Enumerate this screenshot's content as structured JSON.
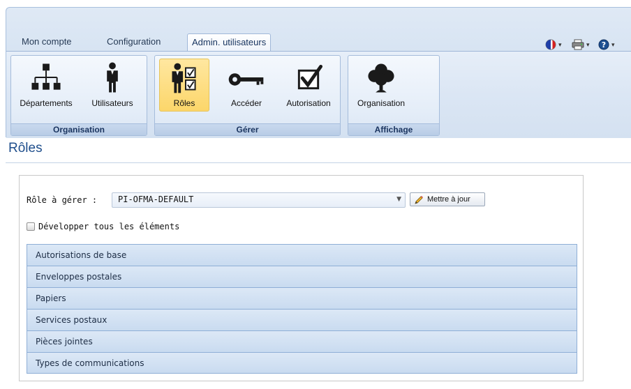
{
  "tabs": [
    {
      "label": "Mon compte",
      "active": false
    },
    {
      "label": "Configuration",
      "active": false
    },
    {
      "label": "Admin. utilisateurs",
      "active": true
    }
  ],
  "toolbar_icons": [
    {
      "name": "flag-icon"
    },
    {
      "name": "printer-icon"
    },
    {
      "name": "help-icon"
    }
  ],
  "groups": [
    {
      "label": "Organisation",
      "buttons": [
        {
          "label": "Départements",
          "icon": "org-chart-icon",
          "selected": false
        },
        {
          "label": "Utilisateurs",
          "icon": "user-icon",
          "selected": false
        }
      ]
    },
    {
      "label": "Gérer",
      "buttons": [
        {
          "label": "Rôles",
          "icon": "user-checklist-icon",
          "selected": true
        },
        {
          "label": "Accéder",
          "icon": "key-icon",
          "selected": false
        },
        {
          "label": "Autorisation",
          "icon": "checkbox-icon",
          "selected": false
        }
      ]
    },
    {
      "label": "Affichage",
      "buttons": [
        {
          "label": "Organisation",
          "icon": "tree-icon",
          "selected": false
        }
      ]
    }
  ],
  "page": {
    "title": "Rôles"
  },
  "form": {
    "role_label": "Rôle à gérer :",
    "role_value": "PI-OFMA-DEFAULT",
    "update_label": "Mettre à jour",
    "expand_label": "Développer tous les éléments",
    "expand_checked": false
  },
  "sections": [
    "Autorisations de base",
    "Enveloppes postales",
    "Papiers",
    "Services postaux",
    "Pièces jointes",
    "Types de communications"
  ],
  "colors": {
    "ribbon": "#d6e3f2",
    "selected_button": "#fcd66a",
    "title": "#1f4e8c",
    "section_bg": "#c9dbf0"
  }
}
